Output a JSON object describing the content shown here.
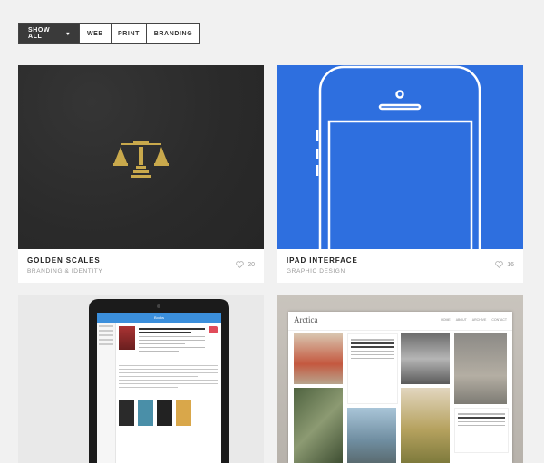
{
  "filters": [
    {
      "label": "SHOW ALL",
      "active": true
    },
    {
      "label": "WEB",
      "active": false
    },
    {
      "label": "PRINT",
      "active": false
    },
    {
      "label": "BRANDING",
      "active": false
    }
  ],
  "cards": [
    {
      "title": "GOLDEN SCALES",
      "category": "BRANDING & IDENTITY",
      "likes": "20"
    },
    {
      "title": "IPAD INTERFACE",
      "category": "GRAPHIC DESIGN",
      "likes": "16"
    },
    {
      "title": "",
      "category": "",
      "likes": ""
    },
    {
      "title": "",
      "category": "",
      "likes": ""
    }
  ],
  "arctica": {
    "logo": "Arctica",
    "nav": [
      "HOME",
      "ABOUT",
      "ARCHIVE",
      "CONTACT"
    ]
  },
  "tablet": {
    "app_title": "Books"
  },
  "colors": {
    "accent_blue": "#2e6fdf",
    "active_filter": "#3a3a3a",
    "gold": "#c9a94c",
    "heart": "#e14b5a"
  },
  "icons": {
    "likes": "heart-outline-icon",
    "filter_dropdown": "chevron-down-icon"
  }
}
